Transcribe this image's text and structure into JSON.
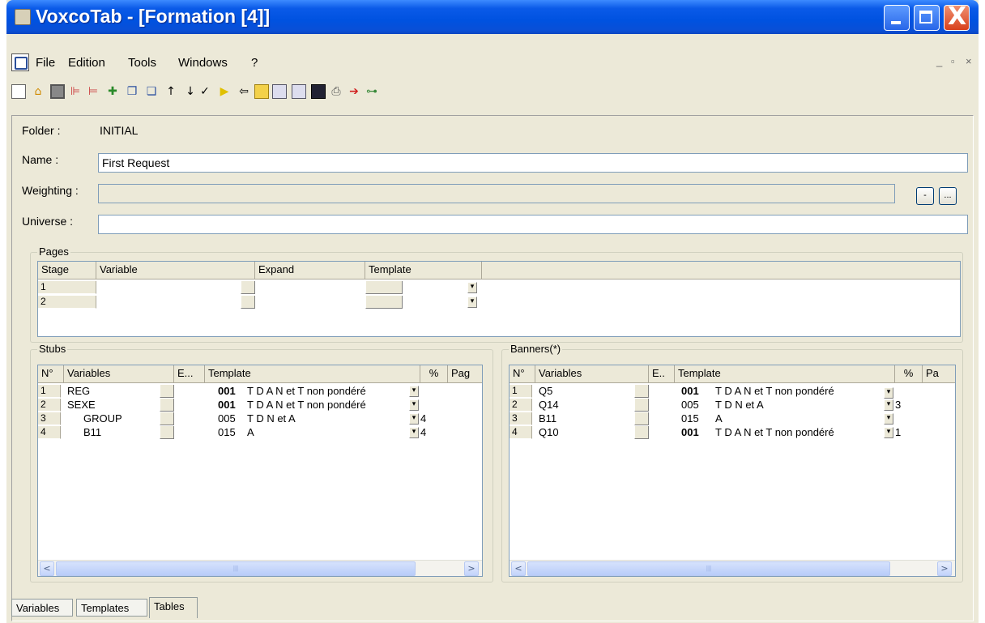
{
  "window": {
    "title": "VoxcoTab - [Formation [4]]",
    "close_glyph": "X"
  },
  "menu": {
    "items": [
      "File",
      "Edition",
      "Tools",
      "Windows",
      "?"
    ],
    "mdi_min": "_",
    "mdi_restore": "̅",
    "mdi_close": "×"
  },
  "toolbar": {
    "icons": [
      "new-icon",
      "open-icon",
      "save-icon",
      "insert-column-icon",
      "insert-row-icon",
      "add-icon",
      "copy-icon",
      "paste-icon",
      "move-up-icon",
      "move-down-icon",
      "validate-icon",
      "run-icon",
      "back-icon",
      "document-icon",
      "list-icon",
      "list2-icon",
      "export-icon",
      "print-icon",
      "exit-icon",
      "tree-icon"
    ],
    "arrow_up": "↑",
    "arrow_down": "↓",
    "check": "✓",
    "play": "▶",
    "back": "⇦"
  },
  "form": {
    "folder_label": "Folder :",
    "folder_value": "INITIAL",
    "name_label": "Name :",
    "name_value": "First Request",
    "weighting_label": "Weighting :",
    "weighting_value": "",
    "weighting_btn1": "-",
    "weighting_btn2": "...",
    "universe_label": "Universe :",
    "universe_value": ""
  },
  "pages": {
    "title": "Pages",
    "columns": [
      "Stage",
      "Variable",
      "Expand",
      "Template"
    ],
    "rows": [
      {
        "num": "1"
      },
      {
        "num": "2"
      }
    ]
  },
  "stubs": {
    "title": "Stubs",
    "columns": [
      "N°",
      "Variables",
      "E...",
      "Template",
      "%",
      "Pag"
    ],
    "rows": [
      {
        "num": "1",
        "var": "REG",
        "code": "001",
        "tpl": "T D A N et T non pondéré",
        "pct": "",
        "bold": true
      },
      {
        "num": "2",
        "var": "SEXE",
        "code": "001",
        "tpl": "T D A N et T non pondéré",
        "pct": "",
        "bold": true
      },
      {
        "num": "3",
        "var": "GROUP",
        "code": "005",
        "tpl": "T D N et A",
        "pct": "4",
        "bold": false
      },
      {
        "num": "4",
        "var": "B11",
        "code": "015",
        "tpl": "A",
        "pct": "4",
        "bold": false
      }
    ]
  },
  "banners": {
    "title": "Banners(*)",
    "columns": [
      "N°",
      "Variables",
      "E..",
      "Template",
      "%",
      "Pa"
    ],
    "rows": [
      {
        "num": "1",
        "var": "Q5",
        "code": "001",
        "tpl": "T D A N et T non pondéré",
        "pct": "",
        "bold": true
      },
      {
        "num": "2",
        "var": "Q14",
        "code": "005",
        "tpl": "T D N et A",
        "pct": "3",
        "bold": false
      },
      {
        "num": "3",
        "var": "B11",
        "code": "015",
        "tpl": "A",
        "pct": "",
        "bold": false
      },
      {
        "num": "4",
        "var": "Q10",
        "code": "001",
        "tpl": "T D A N et T non pondéré",
        "pct": "1",
        "bold": true
      }
    ]
  },
  "scroll": {
    "left": "<",
    "right": ">",
    "grip": "|||"
  },
  "dropdown_glyph": "▾",
  "tabs": [
    "Variables",
    "Templates",
    "Tables"
  ]
}
